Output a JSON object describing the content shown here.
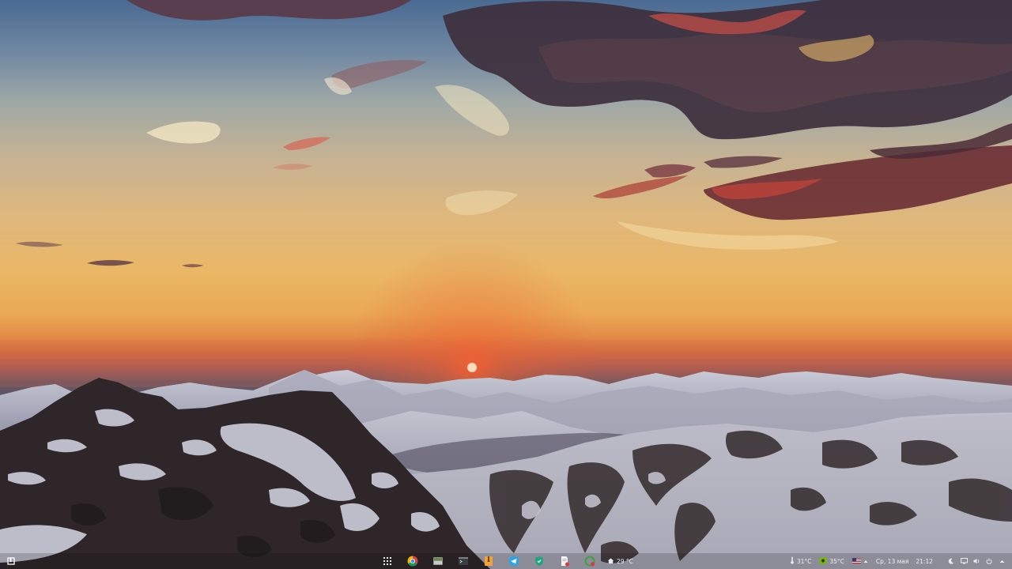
{
  "desktop": {
    "wallpaper": "mountain-sunset"
  },
  "taskbar": {
    "launcher": {
      "icon": "app-menu-square-icon"
    },
    "pinned": [
      {
        "name": "app-grid-icon"
      },
      {
        "name": "chrome-icon"
      },
      {
        "name": "file-manager-icon"
      },
      {
        "name": "terminal-icon"
      },
      {
        "name": "archive-manager-icon"
      },
      {
        "name": "telegram-icon"
      },
      {
        "name": "vpn-shield-icon"
      },
      {
        "name": "document-viewer-icon"
      },
      {
        "name": "updater-icon"
      }
    ],
    "weather": {
      "icon": "house-weather-icon",
      "text": "29 °C"
    },
    "cpu_temp": {
      "icon": "thermometer-icon",
      "text": "31°C"
    },
    "gpu_temp": {
      "icon": "nvidia-icon",
      "text": "35°C"
    },
    "keyboard_layout": {
      "icon": "us-flag-icon"
    },
    "datetime": {
      "date": "Ср, 13 мая",
      "time": "21:12"
    },
    "tray": [
      "night-mode-moon-icon",
      "display-icon",
      "volume-icon",
      "power-icon",
      "tray-expand-arrow-icon"
    ],
    "colors": {
      "chrome_red": "#db4437",
      "chrome_yellow": "#f4b400",
      "chrome_green": "#0f9d58",
      "chrome_blue": "#4285f4",
      "telegram_blue": "#2ca5e0",
      "vpn_green": "#1fa67a",
      "archive_orange": "#f2a33a",
      "nvidia_green": "#76b900"
    }
  }
}
